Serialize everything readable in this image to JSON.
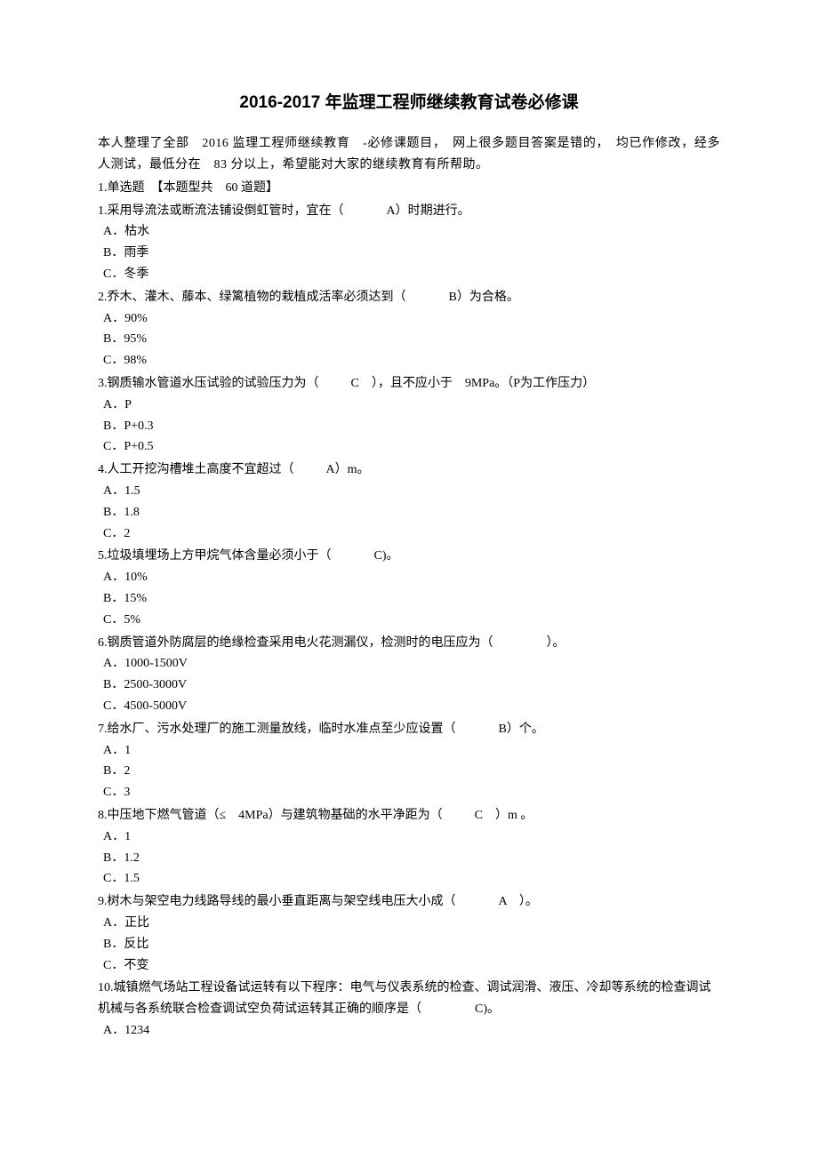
{
  "title": "2016-2017 年监理工程师继续教育试卷必修课",
  "intro": "本人整理了全部　2016 监理工程师继续教育　-必修课题目，　网上很多题目答案是错的，　均已作修改，经多人测试，最低分在　83 分以上，希望能对大家的继续教育有所帮助。",
  "sectionHead": "1.单选题　【本题型共　60 道题】",
  "q1": {
    "stem_a": "1.采用导流法或断流法铺设倒虹管时，宜在（",
    "ans": "A）时期进行。",
    "A": "A．枯水",
    "B": "B．雨季",
    "C": "C．冬季"
  },
  "q2": {
    "stem_a": "2.乔木、灌木、藤本、绿篱植物的栽植成活率必须达到（",
    "ans": "B）为合格。",
    "A": "A．90%",
    "B": "B．95%",
    "C": "C．98%"
  },
  "q3": {
    "stem_a": "3.钢质输水管道水压试验的试验压力为（",
    "ans": "C　），且不应小于　9MPa。（P为工作压力）",
    "A": "A．P",
    "B": "B．P+0.3",
    "C": "C．P+0.5"
  },
  "q4": {
    "stem_a": "4.人工开挖沟槽堆土高度不宜超过（",
    "ans": "A）m。",
    "A": "A．1.5",
    "B": "B．1.8",
    "C": "C．2"
  },
  "q5": {
    "stem_a": "5.垃圾填埋场上方甲烷气体含量必须小于（",
    "ans": "C)。",
    "A": "A．10%",
    "B": "B．15%",
    "C": "C．5%"
  },
  "q6": {
    "stem_a": "6.钢质管道外防腐层的绝缘检查采用电火花测漏仪，检测时的电压应为（",
    "ans": "）。",
    "A": "A．1000-1500V",
    "B": "B．2500-3000V",
    "C": "C．4500-5000V"
  },
  "q7": {
    "stem_a": "7.给水厂、污水处理厂的施工测量放线，临时水准点至少应设置（",
    "ans": "B）个。",
    "A": "A．1",
    "B": "B．2",
    "C": "C．3"
  },
  "q8": {
    "stem_a": "8.中压地下燃气管道（≤　4MPa）与建筑物基础的水平净距为（",
    "ans": "C　）m 。",
    "A": "A．1",
    "B": "B．1.2",
    "C": "C．1.5"
  },
  "q9": {
    "stem_a": "9.树木与架空电力线路导线的最小垂直距离与架空线电压大小成（",
    "ans": "A　）。",
    "A": "A．正比",
    "B": "B．反比",
    "C": "C．不变"
  },
  "q10": {
    "stem": "10.城镇燃气场站工程设备试运转有以下程序：电气与仪表系统的检查、调试润滑、液压、冷却等系统的检查调试机械与各系统联合检查调试空负荷试运转其正确的顺序是（",
    "ans": "C)。",
    "A": "A．1234"
  }
}
